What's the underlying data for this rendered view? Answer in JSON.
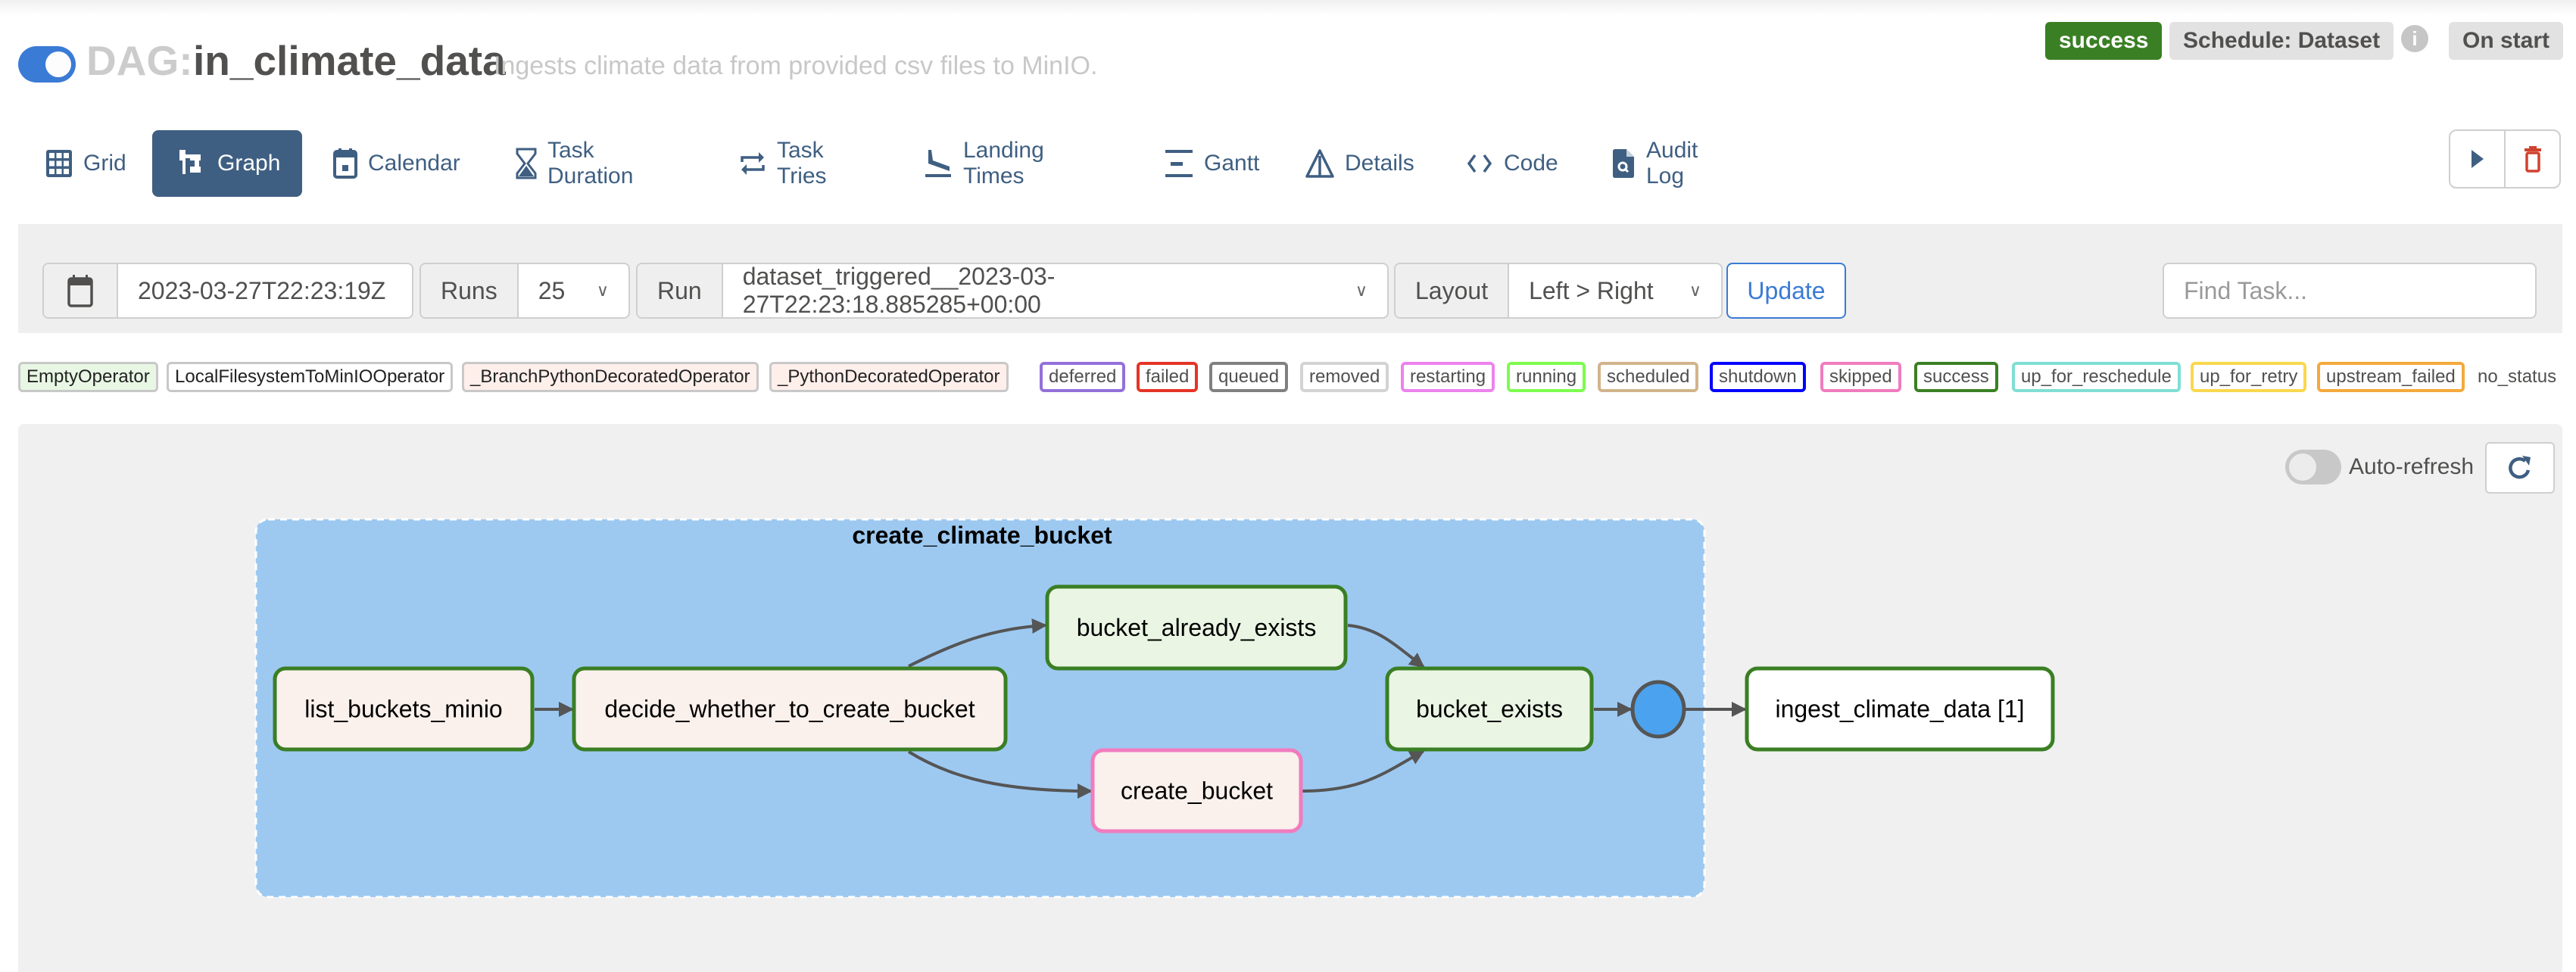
{
  "header": {
    "dag_prefix": "DAG:",
    "dag_id": "in_climate_data",
    "description": "Ingests climate data from provided csv files to MinIO.",
    "paused": false,
    "status_badge": "success",
    "schedule_badge": "Schedule: Dataset",
    "info_icon": "i",
    "trigger_badge": "On start"
  },
  "nav": {
    "tabs": [
      {
        "label": "Grid",
        "icon": "grid-icon"
      },
      {
        "label": "Graph",
        "icon": "graph-icon",
        "active": true
      },
      {
        "label": "Calendar",
        "icon": "calendar-icon"
      },
      {
        "label": "Task Duration",
        "icon": "hourglass-icon"
      },
      {
        "label": "Task Tries",
        "icon": "repeat-icon"
      },
      {
        "label": "Landing Times",
        "icon": "plane-landing-icon"
      },
      {
        "label": "Gantt",
        "icon": "gantt-icon"
      },
      {
        "label": "Details",
        "icon": "details-icon"
      },
      {
        "label": "Code",
        "icon": "code-icon"
      },
      {
        "label": "Audit Log",
        "icon": "file-search-icon"
      }
    ],
    "actions": [
      {
        "name": "trigger-dag",
        "icon": "play-icon"
      },
      {
        "name": "delete-dag",
        "icon": "trash-icon"
      }
    ]
  },
  "filters": {
    "base_date": "2023-03-27T22:23:19Z",
    "runs_label": "Runs",
    "runs_value": "25",
    "run_label": "Run",
    "run_value": "dataset_triggered__2023-03-27T22:23:18.885285+00:00",
    "layout_label": "Layout",
    "layout_value": "Left > Right",
    "update_label": "Update",
    "find_task_placeholder": "Find Task..."
  },
  "legend": {
    "operators": [
      {
        "label": "EmptyOperator",
        "bg": "#e8f7e4"
      },
      {
        "label": "LocalFilesystemToMinIOOperator",
        "bg": "#ffffff"
      },
      {
        "label": "_BranchPythonDecoratedOperator",
        "bg": "#ffefeb"
      },
      {
        "label": "_PythonDecoratedOperator",
        "bg": "#ffefeb"
      }
    ],
    "states": [
      {
        "label": "deferred",
        "color": "#9370db"
      },
      {
        "label": "failed",
        "color": "#e53427"
      },
      {
        "label": "queued",
        "color": "#808080"
      },
      {
        "label": "removed",
        "color": "#d3d3d3"
      },
      {
        "label": "restarting",
        "color": "#ee82ee"
      },
      {
        "label": "running",
        "color": "#7cfc4e"
      },
      {
        "label": "scheduled",
        "color": "#d2b48c"
      },
      {
        "label": "shutdown",
        "color": "#0000ff"
      },
      {
        "label": "skipped",
        "color": "#f07cbe"
      },
      {
        "label": "success",
        "color": "#3a7f24"
      },
      {
        "label": "up_for_reschedule",
        "color": "#7fdfd4"
      },
      {
        "label": "up_for_retry",
        "color": "#f9d84d"
      },
      {
        "label": "upstream_failed",
        "color": "#f4a93c"
      }
    ],
    "no_status": "no_status"
  },
  "graph": {
    "auto_refresh_label": "Auto-refresh",
    "auto_refresh_on": false,
    "task_group": {
      "label": "create_climate_bucket"
    },
    "nodes": [
      {
        "id": "list_buckets_minio",
        "label": "list_buckets_minio",
        "state": "success",
        "operator": "_PythonDecoratedOperator"
      },
      {
        "id": "decide_whether_to_create_bucket",
        "label": "decide_whether_to_create_bucket",
        "state": "success",
        "operator": "_BranchPythonDecoratedOperator"
      },
      {
        "id": "bucket_already_exists",
        "label": "bucket_already_exists",
        "state": "success",
        "operator": "EmptyOperator"
      },
      {
        "id": "create_bucket",
        "label": "create_bucket",
        "state": "skipped",
        "operator": "_PythonDecoratedOperator"
      },
      {
        "id": "bucket_exists",
        "label": "bucket_exists",
        "state": "success",
        "operator": "EmptyOperator"
      },
      {
        "id": "ingest_climate_data",
        "label": "ingest_climate_data [1]",
        "state": "success",
        "operator": "LocalFilesystemToMinIOOperator"
      }
    ],
    "edges": [
      [
        "list_buckets_minio",
        "decide_whether_to_create_bucket"
      ],
      [
        "decide_whether_to_create_bucket",
        "bucket_already_exists"
      ],
      [
        "decide_whether_to_create_bucket",
        "create_bucket"
      ],
      [
        "bucket_already_exists",
        "bucket_exists"
      ],
      [
        "create_bucket",
        "bucket_exists"
      ],
      [
        "bucket_exists",
        "group_join"
      ],
      [
        "group_join",
        "ingest_climate_data"
      ]
    ]
  }
}
